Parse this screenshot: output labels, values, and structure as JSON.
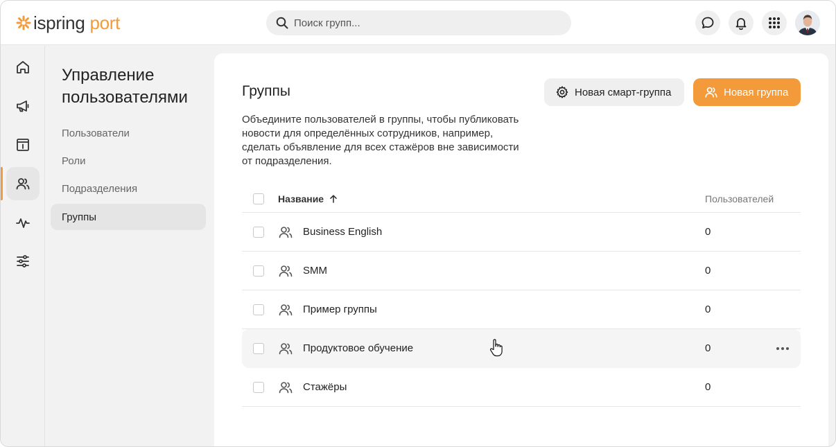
{
  "app": {
    "logo_part1": "ispring",
    "logo_part2": "port",
    "brand_color": "#f39a3a"
  },
  "header": {
    "search_placeholder": "Поиск групп...",
    "icons": [
      "chat-icon",
      "bell-icon",
      "apps-grid-icon",
      "user-avatar"
    ]
  },
  "rail": {
    "items": [
      {
        "icon": "home-icon"
      },
      {
        "icon": "megaphone-icon"
      },
      {
        "icon": "info-board-icon"
      },
      {
        "icon": "users-icon",
        "active": true
      },
      {
        "icon": "activity-icon"
      },
      {
        "icon": "sliders-icon"
      }
    ]
  },
  "subnav": {
    "title": "Управление пользователями",
    "items": [
      {
        "label": "Пользователи"
      },
      {
        "label": "Роли"
      },
      {
        "label": "Подразделения"
      },
      {
        "label": "Группы",
        "active": true
      }
    ]
  },
  "main": {
    "title": "Группы",
    "description": "Объедините пользователей в группы, чтобы публиковать новости для определённых сотрудников, например, сделать объявление для всех стажёров вне зависимости от подразделения.",
    "smart_group_button": "Новая смарт-группа",
    "new_group_button": "Новая группа",
    "table": {
      "col_name": "Название",
      "col_users": "Пользователей",
      "sort": "ascending",
      "rows": [
        {
          "name": "Business English",
          "users": "0"
        },
        {
          "name": "SMM",
          "users": "0"
        },
        {
          "name": "Пример группы",
          "users": "0"
        },
        {
          "name": "Продуктовое обучение",
          "users": "0",
          "hovered": true
        },
        {
          "name": "Стажёры",
          "users": "0"
        }
      ]
    }
  }
}
